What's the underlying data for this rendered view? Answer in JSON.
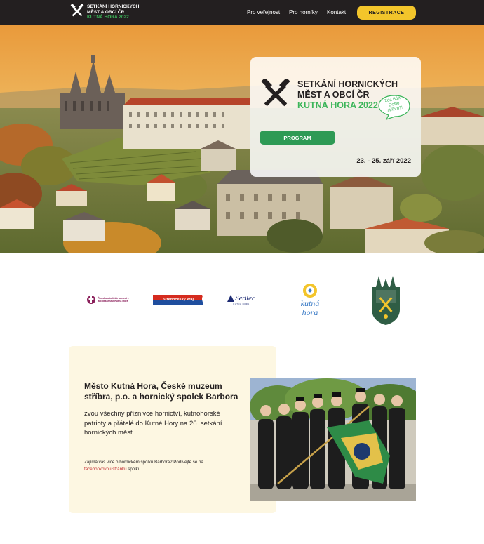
{
  "nav": {
    "logo_line1": "SETKÁNÍ HORNICKÝCH",
    "logo_line2": "MĚST A OBCÍ ČR",
    "logo_line3": "KUTNÁ HORA 2022",
    "links": [
      "Pro veřejnost",
      "Pro horníky",
      "Kontakt"
    ],
    "register_label": "REGISTRACE"
  },
  "hero": {
    "title_line1": "SETKÁNÍ HORNICKÝCH",
    "title_line2": "MĚST A OBCÍ ČR",
    "title_line3": "KUTNÁ HORA 2022",
    "bubble": "Zda Bůh! Došlo stříbro?!",
    "program_label": "PROGRAM",
    "date": "23. - 25. září 2022"
  },
  "partners": {
    "p1_line1": "Římskokatolická farnost –",
    "p1_line2": "arciděkanství Kutná Hora",
    "p2": "Středočeský kraj",
    "p3": "Sedlec",
    "p3_sub": "KUTNÁ HORA",
    "p4_line1": "kutná",
    "p4_line2": "hora"
  },
  "info": {
    "heading": "Město Kutná Hora, České muzeum stříbra, p.o. a hornický spolek Barbora",
    "text": "zvou všechny příznivce hornictví, kutnohorské patrioty a přátelé do Kutné Hory na 26. setkání hornických měst.",
    "small_prefix": "Zajímá vás více o hornickém spolku Barbora? Podívejte se na ",
    "small_link": "facebookovou stránku",
    "small_suffix": " spolku."
  },
  "colors": {
    "nav_bg": "#231f20",
    "accent_yellow": "#f3c52b",
    "accent_green": "#3cb55a",
    "button_green": "#2e9a55",
    "info_bg": "#fdf7e2",
    "link_red": "#c0272d"
  }
}
